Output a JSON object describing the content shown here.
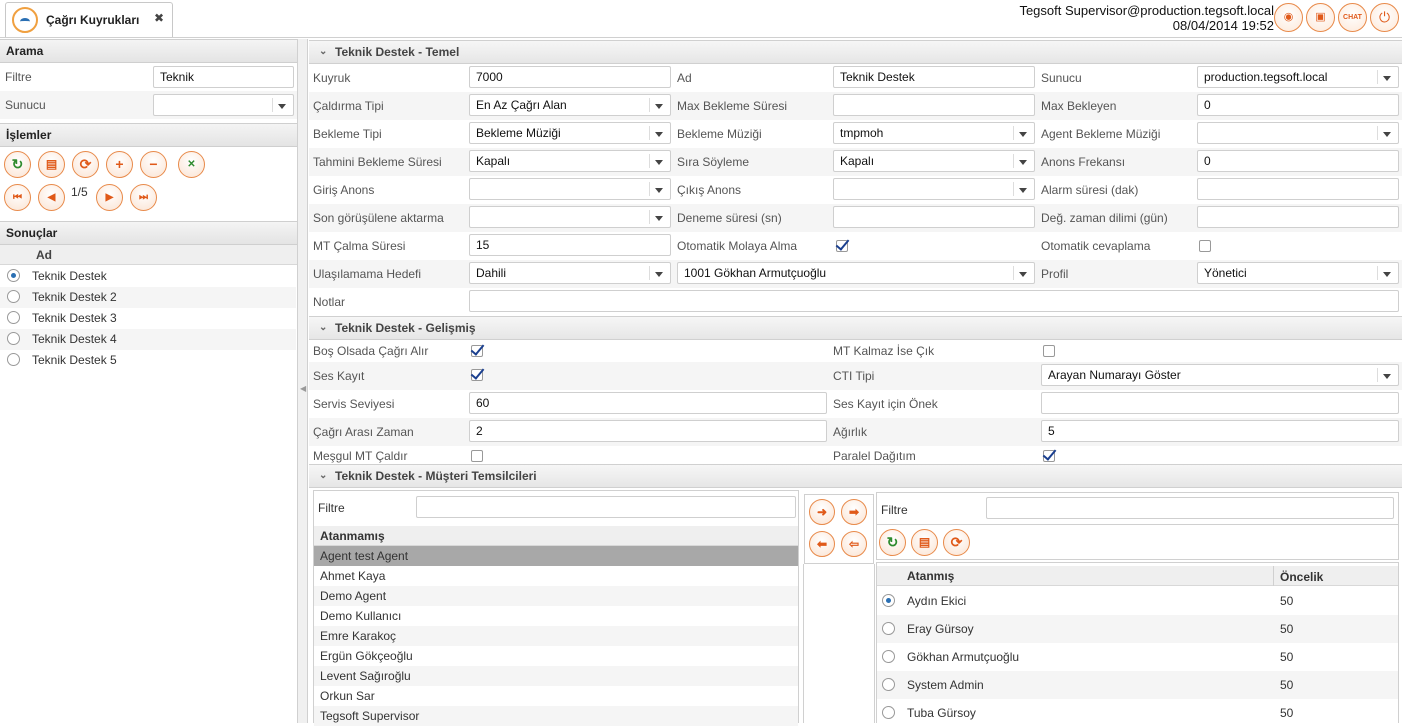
{
  "tab": {
    "title": "Çağrı Kuyrukları",
    "close": "✖"
  },
  "header": {
    "user": "Tegsoft Supervisor@production.tegsoft.local",
    "datetime": "08/04/2014 19:52"
  },
  "left": {
    "search_title": "Arama",
    "filter_label": "Filtre",
    "filter_value": "Teknik",
    "server_label": "Sunucu",
    "server_value": "",
    "ops_title": "İşlemler",
    "pager": "1/5",
    "results_title": "Sonuçlar",
    "results_col": "Ad",
    "results": [
      "Teknik Destek",
      "Teknik Destek 2",
      "Teknik Destek 3",
      "Teknik Destek 4",
      "Teknik Destek 5"
    ]
  },
  "basic": {
    "title": "Teknik Destek - Temel",
    "kuyruk_label": "Kuyruk",
    "kuyruk": "7000",
    "ad_label": "Ad",
    "ad": "Teknik Destek",
    "sunucu_label": "Sunucu",
    "sunucu": "production.tegsoft.local",
    "caldirma_label": "Çaldırma Tipi",
    "caldirma": "En Az Çağrı Alan",
    "maxbekleme_label": "Max Bekleme Süresi",
    "maxbekleme": "",
    "maxbekleyen_label": "Max Bekleyen",
    "maxbekleyen": "0",
    "beklemetipi_label": "Bekleme Tipi",
    "beklemetipi": "Bekleme Müziği",
    "beklememuzigi_label": "Bekleme Müziği",
    "beklememuzigi": "tmpmoh",
    "agentmuzik_label": "Agent Bekleme Müziği",
    "agentmuzik": "",
    "tahmini_label": "Tahmini Bekleme Süresi",
    "tahmini": "Kapalı",
    "sira_label": "Sıra Söyleme",
    "sira": "Kapalı",
    "anons_label": "Anons Frekansı",
    "anons": "0",
    "giris_label": "Giriş Anons",
    "giris": "",
    "cikis_label": "Çıkış Anons",
    "cikis": "",
    "alarm_label": "Alarm süresi (dak)",
    "alarm": "",
    "songorus_label": "Son görüşülene aktarma",
    "songorus": "",
    "deneme_label": "Deneme süresi (sn)",
    "deneme": "",
    "degzaman_label": "Değ. zaman dilimi (gün)",
    "degzaman": "",
    "mtcalma_label": "MT Çalma Süresi",
    "mtcalma": "15",
    "molaya_label": "Otomatik Molaya Alma",
    "otocevap_label": "Otomatik cevaplama",
    "ulasilamama_label": "Ulaşılamama Hedefi",
    "ulasilamama": "Dahili",
    "ulasilamama_target": "1001 Gökhan Armutçuoğlu",
    "profil_label": "Profil",
    "profil": "Yönetici",
    "notlar_label": "Notlar",
    "notlar": ""
  },
  "advanced": {
    "title": "Teknik Destek - Gelişmiş",
    "bos_label": "Boş Olsada Çağrı Alır",
    "mtkalmaz_label": "MT Kalmaz İse Çık",
    "seskayit_label": "Ses Kayıt",
    "cti_label": "CTI Tipi",
    "cti": "Arayan Numarayı Göster",
    "servis_label": "Servis Seviyesi",
    "servis": "60",
    "onek_label": "Ses Kayıt için Önek",
    "onek": "",
    "cagriarasi_label": "Çağrı Arası Zaman",
    "cagriarasi": "2",
    "agirlik_label": "Ağırlık",
    "agirlik": "5",
    "mesgul_label": "Meşgul MT Çaldır",
    "paralel_label": "Paralel Dağıtım"
  },
  "agents": {
    "title": "Teknik Destek - Müşteri Temsilcileri",
    "filter_label": "Filtre",
    "unassigned_header": "Atanmamış",
    "unassigned": [
      "Agent test Agent",
      "Ahmet Kaya",
      "Demo Agent",
      "Demo Kullanıcı",
      "Emre Karakoç",
      "Ergün Gökçeoğlu",
      "Levent Sağıroğlu",
      "Orkun Sar",
      "Tegsoft Supervisor"
    ],
    "assigned_header": "Atanmış",
    "priority_header": "Öncelik",
    "assigned": [
      {
        "name": "Aydın Ekici",
        "priority": "50"
      },
      {
        "name": "Eray Gürsoy",
        "priority": "50"
      },
      {
        "name": "Gökhan Armutçuoğlu",
        "priority": "50"
      },
      {
        "name": "System Admin",
        "priority": "50"
      },
      {
        "name": "Tuba Gürsoy",
        "priority": "50"
      }
    ]
  },
  "colors": {
    "accent": "#e05a1a",
    "selection": "#2a6fb3",
    "check": "#1a3f8f",
    "header_bg": "#e6e6e6"
  }
}
